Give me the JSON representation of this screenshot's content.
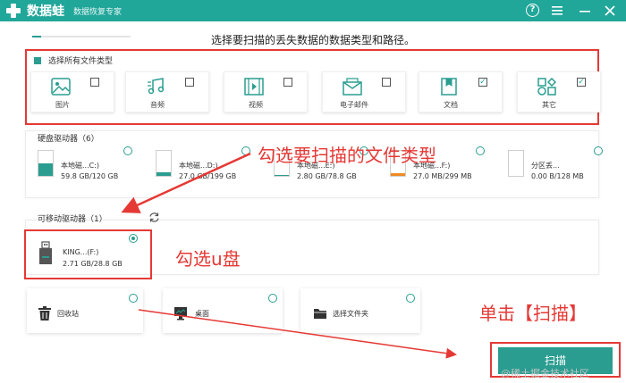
{
  "app": {
    "name": "数据蛙",
    "tagline": "数据恢复专家",
    "help": "?"
  },
  "page_title": "选择要扫描的丢失数据的数据类型和路径。",
  "file_types": {
    "select_all_label": "选择所有文件类型",
    "items": [
      {
        "label": "图片",
        "checked": false,
        "icon": "image-icon"
      },
      {
        "label": "音频",
        "checked": false,
        "icon": "music-note-icon"
      },
      {
        "label": "视频",
        "checked": false,
        "icon": "film-icon"
      },
      {
        "label": "电子邮件",
        "checked": false,
        "icon": "envelope-icon"
      },
      {
        "label": "文档",
        "checked": true,
        "icon": "document-icon"
      },
      {
        "label": "其它",
        "checked": false,
        "icon": "shapes-icon"
      }
    ]
  },
  "hard_drives": {
    "label": "硬盘驱动器（6）",
    "items": [
      {
        "name": "本地磁...C:)",
        "size": "59.8 GB/120 GB",
        "color": "#2a9d90",
        "fill": 0.5
      },
      {
        "name": "本地磁...D:)",
        "size": "27.0 GB/199 GB",
        "color": "#2a9d90",
        "fill": 0.14
      },
      {
        "name": "本地磁...E:)",
        "size": "2.80 GB/78.8 GB",
        "color": "#2a9d90",
        "fill": 0.04
      },
      {
        "name": "本地磁...F:)",
        "size": "27.0 MB/299 MB",
        "color": "#f08a24",
        "fill": 0.09
      },
      {
        "name": "分区丢...",
        "size": "0.00 B/128 MB",
        "color": "#f08a24",
        "fill": 0.0
      }
    ]
  },
  "removable": {
    "label": "可移动驱动器（1）",
    "refresh_icon": "refresh-icon",
    "usb": {
      "name": "KING...(F:)",
      "size": "2.71 GB/28.8 GB",
      "fill": 0.09
    }
  },
  "locations": [
    {
      "label": "回收站",
      "icon": "trash-icon"
    },
    {
      "label": "桌面",
      "icon": "desktop-icon"
    },
    {
      "label": "选择文件夹",
      "icon": "folder-icon"
    }
  ],
  "annotations": {
    "file_type": "勾选要扫描的文件类型",
    "usb": "勾选u盘",
    "scan": "单击【扫描】"
  },
  "scan_label": "扫描",
  "watermark": "@稀土掘金技术社区",
  "colors": {
    "accent": "#2a9d90",
    "titlebar": "#21a69a",
    "annotation": "#e53935",
    "warning": "#f08a24"
  }
}
